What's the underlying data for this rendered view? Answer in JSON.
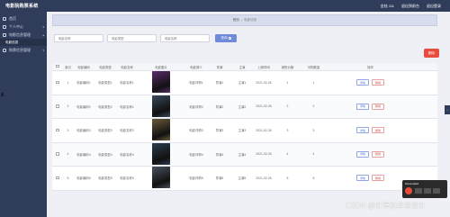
{
  "header": {
    "title": "电影院购票系统",
    "user": "金桂 111",
    "exit_label": "退出到前台",
    "logout_label": "退出登录"
  },
  "sidebar": {
    "items": [
      {
        "label": "首页"
      },
      {
        "label": "个人中心"
      },
      {
        "label": "电影信息管理"
      },
      {
        "label": "电影信息"
      },
      {
        "label": "购票信息管理"
      }
    ]
  },
  "breadcrumb": {
    "home": "首页",
    "current": "电影信息"
  },
  "search": {
    "fields": [
      {
        "placeholder": "电影名称"
      },
      {
        "placeholder": "电影类型"
      },
      {
        "placeholder": "电影名称"
      }
    ],
    "button_label": "查询"
  },
  "delete_button_label": "删除",
  "table": {
    "headers": [
      "",
      "索引",
      "电影编码",
      "电影类型",
      "电影名称",
      "电影图片",
      "电影简介",
      "导演",
      "主演",
      "上映时间",
      "销售价格",
      "可购数量",
      "操作"
    ],
    "rows": [
      {
        "index": "1",
        "code": "电影编码1",
        "type": "电影类型1",
        "name": "电影名称1",
        "intro": "电影详情1",
        "director": "导演1",
        "star": "主演1",
        "date": "2021-02-26",
        "price": "1",
        "qty": "1",
        "poster_color": "#5a2d6b"
      },
      {
        "index": "2",
        "code": "电影编码2",
        "type": "电影类型2",
        "name": "电影名称2",
        "intro": "电影详情2",
        "director": "导演2",
        "star": "主演2",
        "date": "2021-02-26",
        "price": "2",
        "qty": "2",
        "poster_color": "#3a4a5c"
      },
      {
        "index": "3",
        "code": "电影编码3",
        "type": "电影类型3",
        "name": "电影名称3",
        "intro": "电影详情3",
        "director": "导演3",
        "star": "主演3",
        "date": "2021-02-26",
        "price": "3",
        "qty": "3",
        "poster_color": "#6b5a3a"
      },
      {
        "index": "4",
        "code": "电影编码4",
        "type": "电影类型4",
        "name": "电影名称4",
        "intro": "电影详情4",
        "director": "导演4",
        "star": "主演4",
        "date": "2021-02-26",
        "price": "4",
        "qty": "4",
        "poster_color": "#2c3e50"
      },
      {
        "index": "5",
        "code": "电影编码5",
        "type": "电影类型5",
        "name": "电影名称5",
        "intro": "电影详情5",
        "director": "导演5",
        "star": "主演5",
        "date": "2021-02-26",
        "price": "5",
        "qty": "5",
        "poster_color": "#4a5060"
      }
    ],
    "op_detail": "详情",
    "op_delete": "删除"
  },
  "watermark": "CSDN @计算机毕业设计",
  "popup": {
    "title": "Screenshot"
  },
  "colors": {
    "header_bg": "#2f3c5a",
    "accent": "#6f8ad8",
    "danger": "#e74c3c"
  }
}
